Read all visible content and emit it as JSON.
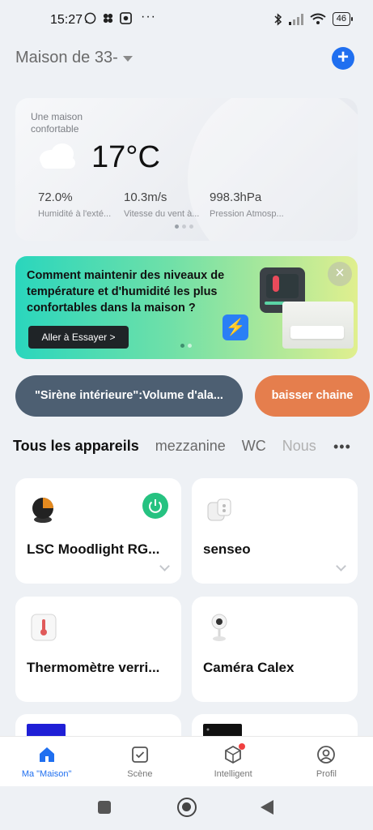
{
  "status_bar": {
    "time": "15:27",
    "battery": "46",
    "left_icons": [
      "whatsapp-icon",
      "clover-icon",
      "app-icon",
      "more-dots-icon"
    ],
    "right_icons": [
      "bluetooth-icon",
      "signal-icon",
      "wifi-icon",
      "battery-icon"
    ]
  },
  "header": {
    "home_name": "Maison de 33-",
    "add_icon": "plus-icon"
  },
  "weather": {
    "subtitle": "Une maison confortable",
    "temperature": "17°C",
    "icon": "cloud-icon",
    "stats": [
      {
        "value": "72.0%",
        "label": "Humidité à l'exté..."
      },
      {
        "value": "10.3m/s",
        "label": "Vitesse du vent à..."
      },
      {
        "value": "998.3hPa",
        "label": "Pression Atmosp..."
      }
    ]
  },
  "banner": {
    "text": "Comment maintenir des niveaux de température et d'humidité les plus confortables dans la maison ?",
    "button_label": "Aller à Essayer >",
    "close_icon": "close-icon"
  },
  "scenes": {
    "scene_label": "\"Sirène intérieure\":Volume d'ala...",
    "action_label": "baisser chaine"
  },
  "tabs": {
    "items": [
      "Tous les appareils",
      "mezzanine",
      "WC",
      "Nous"
    ],
    "more": "•••"
  },
  "devices": [
    {
      "name": "LSC Moodlight RG...",
      "icon": "moodlight-icon",
      "power": "on"
    },
    {
      "name": "senseo",
      "icon": "plug-icon"
    },
    {
      "name": "Thermomètre verri...",
      "icon": "thermometer-icon"
    },
    {
      "name": "Caméra Calex",
      "icon": "camera-icon"
    },
    {
      "name": "",
      "icon": "device-icon"
    },
    {
      "name": "",
      "icon": "device-icon"
    }
  ],
  "bottom_nav": [
    {
      "label": "Ma \"Maison\"",
      "icon": "home-icon",
      "active": true
    },
    {
      "label": "Scène",
      "icon": "scene-icon"
    },
    {
      "label": "Intelligent",
      "icon": "smart-icon"
    },
    {
      "label": "Profil",
      "icon": "profile-icon"
    }
  ],
  "colors": {
    "accent": "#1f6ff0",
    "power_on": "#26c281",
    "scene_pill": "#4d5f72",
    "action_pill": "#e57e4d"
  }
}
